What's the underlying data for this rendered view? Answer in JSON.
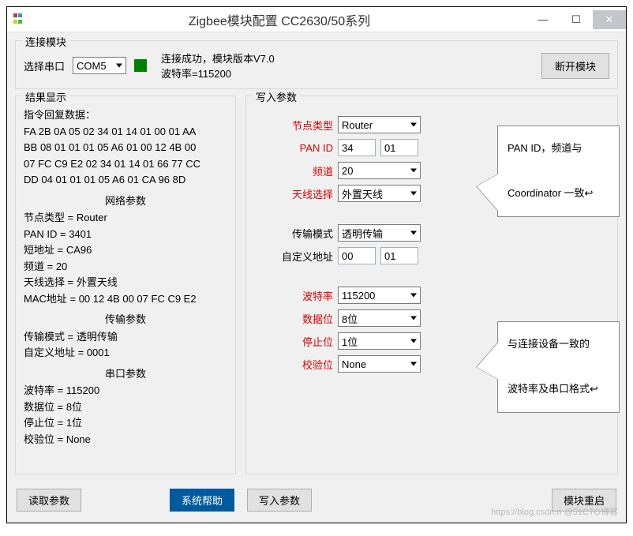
{
  "window": {
    "title": "Zigbee模块配置 CC2630/50系列"
  },
  "connect": {
    "group_title": "连接模块",
    "port_label": "选择串口",
    "port_value": "COM5",
    "status_line1": "连接成功，模块版本V7.0",
    "status_line2": "波特率=115200",
    "disconnect_btn": "断开模块"
  },
  "result": {
    "group_title": "结果显示",
    "header": "指令回复数据：",
    "hex1": "FA 2B 0A 05 02 34 01 14 01 00 01 AA",
    "hex2": "BB 08 01 01 01 05 A6 01 00 12 4B 00",
    "hex3": "07 FC C9 E2 02 34 01 14 01 66 77 CC",
    "hex4": "DD 04 01 01 01 05 A6 01 CA 96 8D",
    "net_h": "网络参数",
    "net1": "节点类型 = Router",
    "net2": "PAN ID = 3401",
    "net3": "短地址 = CA96",
    "net4": "频道 = 20",
    "net5": "天线选择 = 外置天线",
    "net6": "MAC地址 = 00 12 4B 00 07 FC C9 E2",
    "trans_h": "传输参数",
    "trans1": "传输模式 = 透明传输",
    "trans2": "自定义地址 = 0001",
    "serial_h": "串口参数",
    "serial1": "波特率 = 115200",
    "serial2": "数据位 = 8位",
    "serial3": "停止位 = 1位",
    "serial4": "校验位 = None"
  },
  "write": {
    "group_title": "写入参数",
    "node_type_label": "节点类型",
    "node_type_value": "Router",
    "panid_label": "PAN ID",
    "panid_v1": "34",
    "panid_v2": "01",
    "channel_label": "频道",
    "channel_value": "20",
    "antenna_label": "天线选择",
    "antenna_value": "外置天线",
    "trans_mode_label": "传输模式",
    "trans_mode_value": "透明传输",
    "custom_addr_label": "自定义地址",
    "custom_addr_v1": "00",
    "custom_addr_v2": "01",
    "baud_label": "波特率",
    "baud_value": "115200",
    "databits_label": "数据位",
    "databits_value": "8位",
    "stopbits_label": "停止位",
    "stopbits_value": "1位",
    "parity_label": "校验位",
    "parity_value": "None"
  },
  "buttons": {
    "read": "读取参数",
    "help": "系统帮助",
    "write": "写入参数",
    "restart": "模块重启"
  },
  "callouts": {
    "top": "PAN ID，频道与\n\nCoordinator 一致↩",
    "bottom": "与连接设备一致的\n\n波特率及串口格式↩"
  },
  "watermark": "https://blog.csdn.n  @51CTO博客"
}
